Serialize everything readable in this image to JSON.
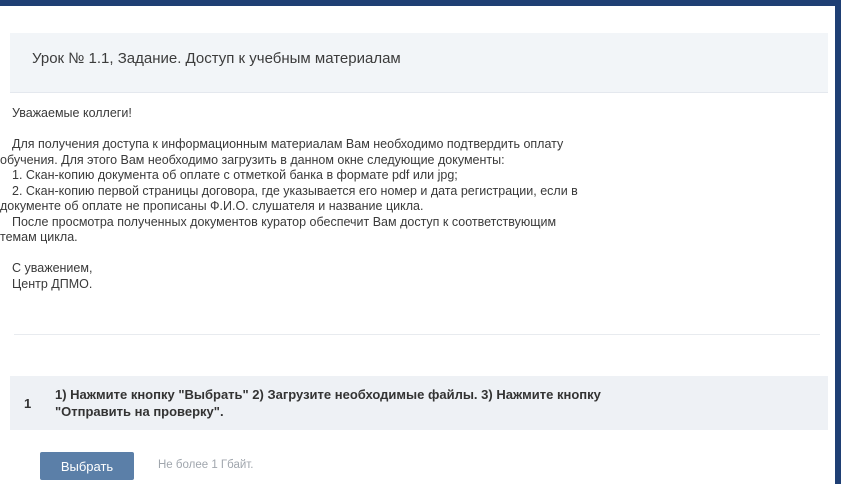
{
  "header": {
    "title": "Урок № 1.1, Задание. Доступ к учебным материалам"
  },
  "message": {
    "greeting": "Уважаемые коллеги!",
    "lines": [
      "Для получения доступа к информационным материалам Вам необходимо подтвердить оплату",
      "обучения. Для этого Вам необходимо загрузить в данном окне следующие документы:",
      "1. Скан-копию документа об оплате с отметкой банка в формате pdf или jpg;",
      "2. Скан-копию первой страницы договора, где указывается его номер и дата регистрации, если в",
      "документе об оплате не прописаны Ф.И.О. слушателя и название цикла.",
      "После просмотра полученных документов куратор обеспечит Вам доступ к соответствующим",
      "темам цикла."
    ],
    "closing": "С уважением,",
    "signature": "Центр ДПМО."
  },
  "step": {
    "number": "1",
    "line1": "1) Нажмите кнопку \"Выбрать\" 2) Загрузите необходимые файлы. 3) Нажмите кнопку",
    "line2": "\"Отправить на проверку\"."
  },
  "upload": {
    "button_label": "Выбрать",
    "limit_text": "Не более 1 Гбайт."
  }
}
